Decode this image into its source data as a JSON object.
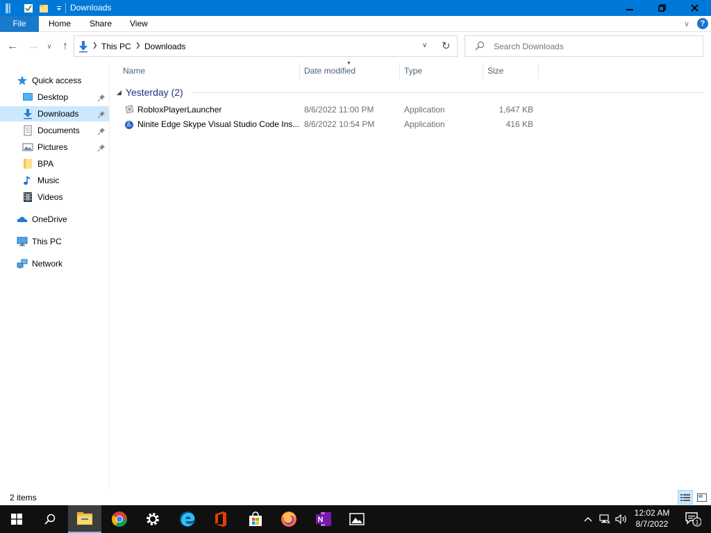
{
  "window": {
    "title": "Downloads"
  },
  "ribbon": {
    "file": "File",
    "home": "Home",
    "share": "Share",
    "view": "View",
    "help": "?"
  },
  "address": {
    "crumbs": [
      "This PC",
      "Downloads"
    ]
  },
  "search": {
    "placeholder": "Search Downloads"
  },
  "nav": {
    "items": [
      {
        "label": "Quick access",
        "icon": "star-icon"
      },
      {
        "label": "Desktop",
        "icon": "desktop-folder-icon",
        "pinned": true
      },
      {
        "label": "Downloads",
        "icon": "downloads-folder-icon",
        "pinned": true,
        "selected": true
      },
      {
        "label": "Documents",
        "icon": "documents-folder-icon",
        "pinned": true
      },
      {
        "label": "Pictures",
        "icon": "pictures-folder-icon",
        "pinned": true
      },
      {
        "label": "BPA",
        "icon": "folder-icon"
      },
      {
        "label": "Music",
        "icon": "music-folder-icon"
      },
      {
        "label": "Videos",
        "icon": "videos-folder-icon"
      },
      {
        "label": "OneDrive",
        "icon": "onedrive-cloud-icon"
      },
      {
        "label": "This PC",
        "icon": "computer-icon"
      },
      {
        "label": "Network",
        "icon": "network-icon"
      }
    ]
  },
  "columns": {
    "name": "Name",
    "date": "Date modified",
    "type": "Type",
    "size": "Size"
  },
  "group": {
    "label": "Yesterday (2)"
  },
  "files": [
    {
      "name": "RobloxPlayerLauncher",
      "date": "8/6/2022 11:00 PM",
      "type": "Application",
      "size": "1,647 KB",
      "icon": "roblox-app-icon"
    },
    {
      "name": "Ninite Edge Skype Visual Studio Code Ins...",
      "date": "8/6/2022 10:54 PM",
      "type": "Application",
      "size": "416 KB",
      "icon": "ninite-app-icon"
    }
  ],
  "status": {
    "count": "2 items"
  },
  "clock": {
    "time": "12:02 AM",
    "date": "8/7/2022"
  },
  "notifications": {
    "count": "1"
  },
  "colors": {
    "accent": "#0078d7",
    "selection": "#cce8ff",
    "group_text": "#1e3287",
    "taskbar": "#101010"
  }
}
